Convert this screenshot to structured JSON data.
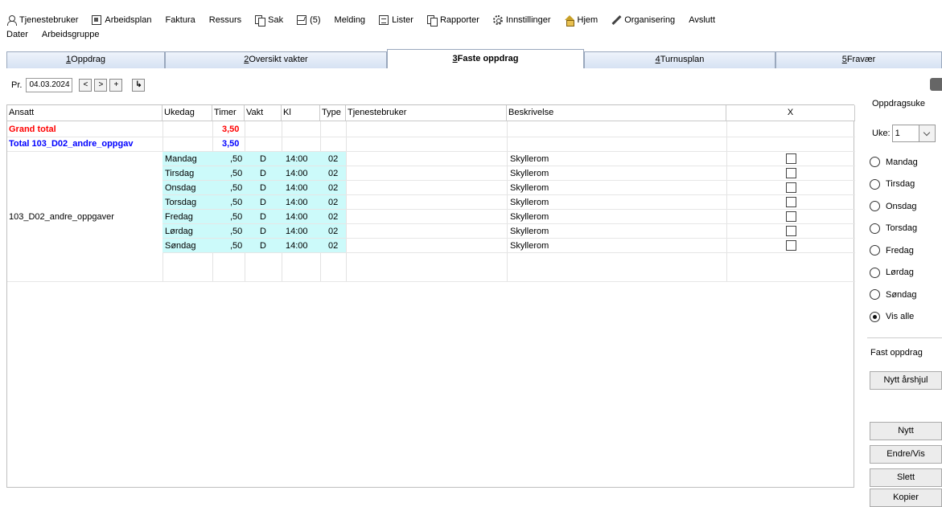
{
  "menu": {
    "row1": [
      {
        "label": "Tjenestebruker",
        "icon": "user-icon"
      },
      {
        "label": "Arbeidsplan",
        "icon": "plan-icon"
      },
      {
        "label": "Faktura",
        "icon": ""
      },
      {
        "label": "Ressurs",
        "icon": ""
      },
      {
        "label": "Sak",
        "icon": "copy-icon"
      },
      {
        "label": "(5)",
        "icon": "mail-icon"
      },
      {
        "label": "Melding",
        "icon": ""
      },
      {
        "label": "Lister",
        "icon": "list-icon"
      },
      {
        "label": "Rapporter",
        "icon": "copy-icon"
      },
      {
        "label": "Innstillinger",
        "icon": "gear-icon"
      },
      {
        "label": "Hjem",
        "icon": "home-icon"
      },
      {
        "label": "Organisering",
        "icon": "pen-icon"
      },
      {
        "label": "Avslutt",
        "icon": ""
      }
    ],
    "row2": [
      {
        "label": "Dater"
      },
      {
        "label": "Arbeidsgruppe"
      }
    ]
  },
  "tabs": [
    {
      "num": "1",
      "label": "Oppdrag"
    },
    {
      "num": "2",
      "label": "Oversikt vakter"
    },
    {
      "num": "3",
      "label": "Faste oppdrag"
    },
    {
      "num": "4",
      "label": "Turnusplan"
    },
    {
      "num": "5",
      "label": "Fravær"
    }
  ],
  "toolbar": {
    "pr_label": "Pr.",
    "date_value": "04.03.2024",
    "prev": "<",
    "next": ">",
    "plus": "+",
    "arrow": "↳"
  },
  "grid": {
    "headers": [
      "Ansatt",
      "Ukedag",
      "Timer",
      "Vakt",
      "Kl",
      "Type",
      "Tjenestebruker",
      "Beskrivelse",
      "X"
    ],
    "grand_total_label": "Grand total",
    "grand_total_value": "3,50",
    "total_label": "Total 103_D02_andre_oppgav",
    "total_value": "3,50",
    "employee": "103_D02_andre_oppgaver",
    "rows": [
      {
        "day": "Mandag",
        "hours": ",50",
        "shift": "D",
        "time": "14:00",
        "type": "02",
        "desc": "Skyllerom"
      },
      {
        "day": "Tirsdag",
        "hours": ",50",
        "shift": "D",
        "time": "14:00",
        "type": "02",
        "desc": "Skyllerom"
      },
      {
        "day": "Onsdag",
        "hours": ",50",
        "shift": "D",
        "time": "14:00",
        "type": "02",
        "desc": "Skyllerom"
      },
      {
        "day": "Torsdag",
        "hours": ",50",
        "shift": "D",
        "time": "14:00",
        "type": "02",
        "desc": "Skyllerom"
      },
      {
        "day": "Fredag",
        "hours": ",50",
        "shift": "D",
        "time": "14:00",
        "type": "02",
        "desc": "Skyllerom"
      },
      {
        "day": "Lørdag",
        "hours": ",50",
        "shift": "D",
        "time": "14:00",
        "type": "02",
        "desc": "Skyllerom"
      },
      {
        "day": "Søndag",
        "hours": ",50",
        "shift": "D",
        "time": "14:00",
        "type": "02",
        "desc": "Skyllerom"
      }
    ]
  },
  "panel": {
    "group1_title": "Oppdragsuke",
    "uke_label": "Uke:",
    "uke_value": "1",
    "radios": [
      "Mandag",
      "Tirsdag",
      "Onsdag",
      "Torsdag",
      "Fredag",
      "Lørdag",
      "Søndag",
      "Vis alle"
    ],
    "selected_radio": "Vis alle",
    "group2_title": "Fast oppdrag",
    "buttons": [
      "Nytt årshjul",
      "Nytt",
      "Endre/Vis",
      "Slett",
      "Kopier"
    ]
  },
  "colors": {
    "grand_total": "#ff0000",
    "total": "#0000ff",
    "weekday_cells": "#ccfafa"
  }
}
